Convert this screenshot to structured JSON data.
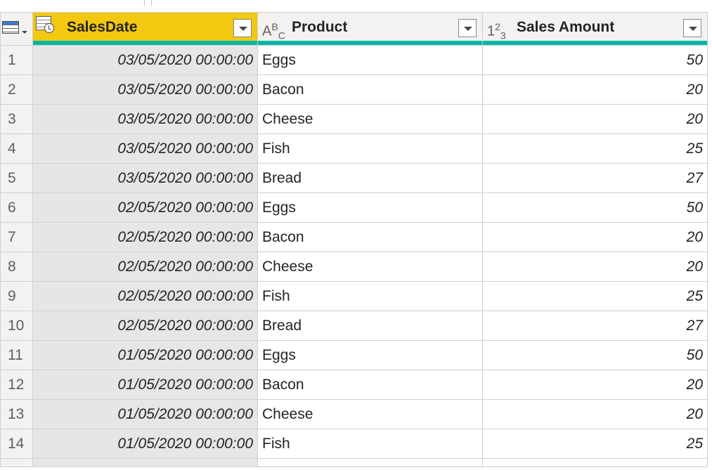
{
  "columns": {
    "date": {
      "label": "SalesDate",
      "type_icon": "datetime-icon"
    },
    "product": {
      "label": "Product",
      "type_icon": "text-type-icon",
      "type_glyph": "ABC"
    },
    "amount": {
      "label": "Sales Amount",
      "type_icon": "number-type-icon",
      "type_glyph": "123"
    }
  },
  "rows": [
    {
      "num": "1",
      "date": "03/05/2020 00:00:00",
      "product": "Eggs",
      "amount": "50"
    },
    {
      "num": "2",
      "date": "03/05/2020 00:00:00",
      "product": "Bacon",
      "amount": "20"
    },
    {
      "num": "3",
      "date": "03/05/2020 00:00:00",
      "product": "Cheese",
      "amount": "20"
    },
    {
      "num": "4",
      "date": "03/05/2020 00:00:00",
      "product": "Fish",
      "amount": "25"
    },
    {
      "num": "5",
      "date": "03/05/2020 00:00:00",
      "product": "Bread",
      "amount": "27"
    },
    {
      "num": "6",
      "date": "02/05/2020 00:00:00",
      "product": "Eggs",
      "amount": "50"
    },
    {
      "num": "7",
      "date": "02/05/2020 00:00:00",
      "product": "Bacon",
      "amount": "20"
    },
    {
      "num": "8",
      "date": "02/05/2020 00:00:00",
      "product": "Cheese",
      "amount": "20"
    },
    {
      "num": "9",
      "date": "02/05/2020 00:00:00",
      "product": "Fish",
      "amount": "25"
    },
    {
      "num": "10",
      "date": "02/05/2020 00:00:00",
      "product": "Bread",
      "amount": "27"
    },
    {
      "num": "11",
      "date": "01/05/2020 00:00:00",
      "product": "Eggs",
      "amount": "50"
    },
    {
      "num": "12",
      "date": "01/05/2020 00:00:00",
      "product": "Bacon",
      "amount": "20"
    },
    {
      "num": "13",
      "date": "01/05/2020 00:00:00",
      "product": "Cheese",
      "amount": "20"
    },
    {
      "num": "14",
      "date": "01/05/2020 00:00:00",
      "product": "Fish",
      "amount": "25"
    }
  ],
  "colors": {
    "selected_header": "#f2c811",
    "quality_bar": "#00b7a4",
    "selected_column_cells": "#e6e6e6"
  }
}
